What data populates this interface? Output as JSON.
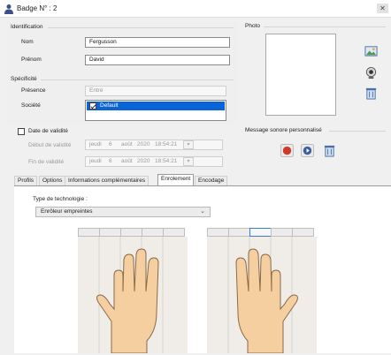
{
  "window": {
    "title": "Badge N° : 2",
    "close": "✕"
  },
  "identification": {
    "title": "Identification",
    "nom_label": "Nom",
    "nom_value": "Fergusson",
    "prenom_label": "Prénom",
    "prenom_value": "David"
  },
  "specificite": {
    "title": "Spécificité",
    "presence_label": "Présence",
    "presence_value": "Entré",
    "societe_label": "Société",
    "societe_item": "Default",
    "societe_item_checked": true
  },
  "validite": {
    "checkbox_label": "Date de validité",
    "checked": false,
    "debut_label": "Début de validité",
    "fin_label": "Fin de validité",
    "debut": {
      "day": "jeudi",
      "num": "6",
      "month": "août",
      "year": "2020",
      "time": "18:54:21"
    },
    "fin": {
      "day": "jeudi",
      "num": "6",
      "month": "août",
      "year": "2020",
      "time": "18:54:21"
    }
  },
  "photo": {
    "title": "Photo",
    "icons": [
      "photo-select-icon",
      "webcam-icon",
      "photo-delete-icon"
    ]
  },
  "sound": {
    "title": "Message sonore personnalisé",
    "icons": [
      "record-icon",
      "play-icon",
      "sound-delete-icon"
    ]
  },
  "tabs": [
    {
      "label": "Profils"
    },
    {
      "label": "Options"
    },
    {
      "label": "Informations complémentaires"
    },
    {
      "label": "Enrolement",
      "active": true
    },
    {
      "label": "Encodage"
    }
  ],
  "enrolement": {
    "techno_label": "Type de technologie :",
    "techno_value": "Enrôleur empreintes",
    "selected_finger": "right-index"
  },
  "colors": {
    "accent": "#3a7bd5",
    "selection": "#0a64d8",
    "record": "#d03a2a",
    "skin": "#f5cfa0"
  }
}
